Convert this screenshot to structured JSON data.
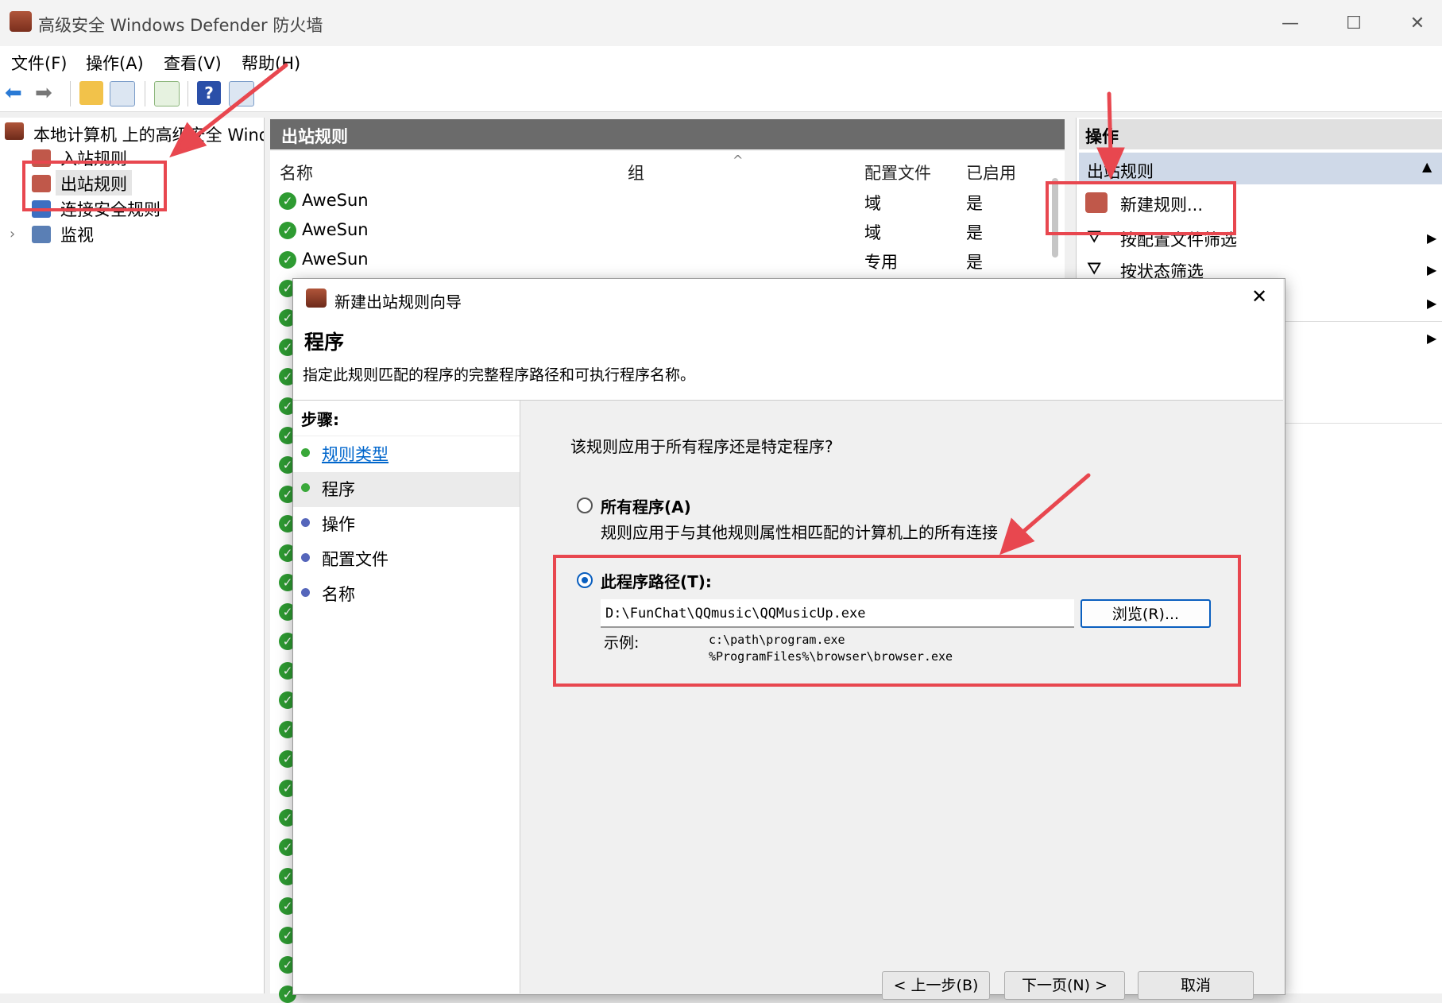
{
  "window": {
    "title": "高级安全 Windows Defender 防火墙"
  },
  "menu": [
    "文件(F)",
    "操作(A)",
    "查看(V)",
    "帮助(H)"
  ],
  "tree": {
    "root": "本地计算机 上的高级安全 Windows",
    "items": [
      "入站规则",
      "出站规则",
      "连接安全规则",
      "监视"
    ]
  },
  "center": {
    "title": "出站规则",
    "columns": [
      "名称",
      "组",
      "配置文件",
      "已启用"
    ],
    "rows": [
      {
        "name": "AweSun",
        "group": "",
        "profile": "域",
        "enabled": "是"
      },
      {
        "name": "AweSun",
        "group": "",
        "profile": "域",
        "enabled": "是"
      },
      {
        "name": "AweSun",
        "group": "",
        "profile": "专用",
        "enabled": "是"
      }
    ]
  },
  "actions": {
    "title": "操作",
    "section": "出站规则",
    "items": [
      "新建规则...",
      "按配置文件筛选",
      "按状态筛选"
    ]
  },
  "dialog": {
    "title": "新建出站规则向导",
    "heading": "程序",
    "description": "指定此规则匹配的程序的完整程序路径和可执行程序名称。",
    "steps_label": "步骤:",
    "steps": [
      "规则类型",
      "程序",
      "操作",
      "配置文件",
      "名称"
    ],
    "question": "该规则应用于所有程序还是特定程序?",
    "option_all": {
      "label": "所有程序(A)",
      "desc": "规则应用于与其他规则属性相匹配的计算机上的所有连接"
    },
    "option_path": {
      "label": "此程序路径(T):",
      "value": "D:\\FunChat\\QQmusic\\QQMusicUp.exe"
    },
    "browse": "浏览(R)...",
    "example_label": "示例:",
    "example_1": "c:\\path\\program.exe",
    "example_2": "%ProgramFiles%\\browser\\browser.exe",
    "buttons": {
      "back": "< 上一步(B)",
      "next": "下一页(N) >",
      "cancel": "取消"
    }
  },
  "colors": {
    "annotation_red": "#e8474f",
    "link_blue": "#0066cc",
    "check_green": "#2e9b32"
  }
}
